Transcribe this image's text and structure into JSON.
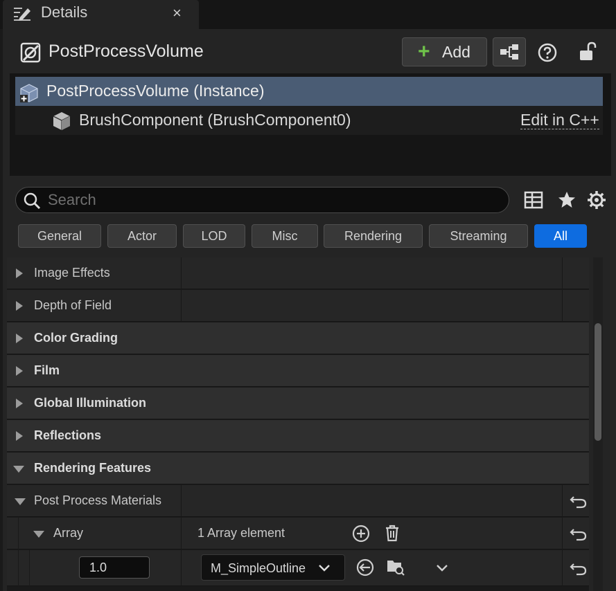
{
  "tab": {
    "title": "Details",
    "close": "×"
  },
  "header": {
    "title": "PostProcessVolume",
    "add_label": "Add"
  },
  "tree": {
    "instance": "PostProcessVolume (Instance)",
    "component": "BrushComponent (BrushComponent0)",
    "edit_link": "Edit in C++"
  },
  "search": {
    "placeholder": "Search"
  },
  "filters": [
    "General",
    "Actor",
    "LOD",
    "Misc",
    "Rendering",
    "Streaming",
    "All"
  ],
  "filters_active": "All",
  "properties": {
    "image_effects": "Image Effects",
    "depth_of_field": "Depth of Field",
    "color_grading": "Color Grading",
    "film": "Film",
    "global_illumination": "Global Illumination",
    "reflections": "Reflections",
    "rendering_features": "Rendering Features",
    "post_process_materials": "Post Process Materials",
    "array": "Array",
    "array_count": "1 Array element",
    "element_weight": "1.0",
    "element_material": "M_SimpleOutline"
  },
  "colors": {
    "accent": "#0e6ce0",
    "selection": "#4a5c74",
    "add_plus": "#6fc24a"
  }
}
